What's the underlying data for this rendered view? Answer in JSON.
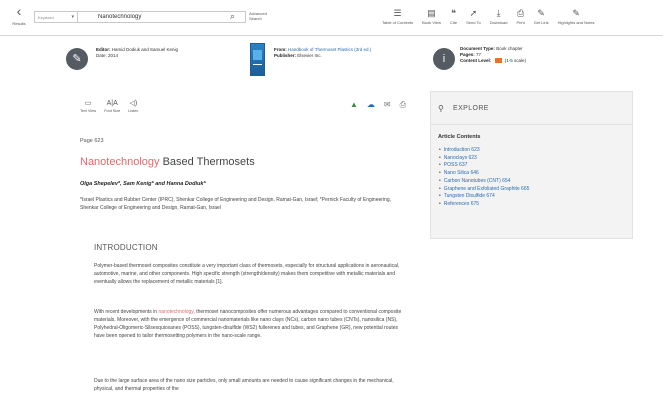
{
  "toolbar": {
    "back_label": "Results",
    "search_scope": "Keyword",
    "search_value": "Nanotechnology",
    "advanced_search": "Advanced Search",
    "tools": [
      {
        "icon": "table-of-contents-icon",
        "glyph": "☰",
        "label": "Table of Contents"
      },
      {
        "icon": "book-view-icon",
        "glyph": "▤",
        "label": "Book View"
      },
      {
        "icon": "cite-icon",
        "glyph": "❝",
        "label": "Cite"
      },
      {
        "icon": "send-to-icon",
        "glyph": "➚",
        "label": "Send To"
      },
      {
        "icon": "download-icon",
        "glyph": "⤓",
        "label": "Download"
      },
      {
        "icon": "print-icon",
        "glyph": "⎙",
        "label": "Print"
      },
      {
        "icon": "get-link-icon",
        "glyph": "✎",
        "label": "Get Link"
      },
      {
        "icon": "highlights-notes-icon",
        "glyph": "✎",
        "label": "Highlights and Notes"
      }
    ]
  },
  "header": {
    "editor_label": "Editor:",
    "editor_value": "Hamid Dodiuk and Samuel Kenig",
    "editor_line2": "Date: 2014",
    "from_label": "From:",
    "from_value": "Handbook of Thermoset Plastics (3rd ed.)",
    "publisher_label": "Publisher:",
    "publisher_value": "Elsevier Inc.",
    "doctype_label": "Document Type:",
    "doctype_value": "Book chapter",
    "pages_label": "Pages:",
    "pages_value": "77",
    "content_level_label": "Content Level:",
    "content_level_value": "(1-5 scale)"
  },
  "article": {
    "doc_tools": [
      {
        "icon": "text-view-icon",
        "glyph": "▭",
        "label": "Text View"
      },
      {
        "icon": "font-size-icon",
        "glyph": "A|A",
        "label": "Font Size"
      },
      {
        "icon": "listen-icon",
        "glyph": "◁)",
        "label": "Listen"
      }
    ],
    "page": "Page 623",
    "title_highlight": "Nanotechnology",
    "title_rest": " Based Thermosets",
    "authors": "Olga Shepelev*, Sam Kenig* and Hanna Dodiuk*",
    "affiliation": "*Israel Plastics and Rubber Center (IPRC), Shenkar College of Engineering and Design, Ramat-Gan, Israel; *Pernick Faculty of Engineering, Shenkar College of Engineering and Design, Ramat-Gan, Israel",
    "section": "INTRODUCTION",
    "p1": "Polymer-based thermoset composites constitute a very important class of thermosets, especially for structural applications in aeronautical, automotive, marine, and other components. High specific strength (strength/density) makes them competitive with metallic materials and eventually allows the replacement of metallic materials [1].",
    "p2_pre": "With recent developments in ",
    "p2_highlight": "nanotechnology",
    "p2_post": ", thermoset nanocomposites offer numerous advantages compared to conventional composite materials. Moreover, with the emergence of commercial nanomaterials like nano clays (NCs), carbon nano tubes (CNTs), nanosilica (NS), Polyhedral-Oligomeric-Silsesquioxanes (POSS), tungsten-disulfide (WS2) fullerenes and tubes, and Graphene (GR), new potential routes have been opened to tailor thermosetting polymers in the nano-scale range.",
    "p3": "Due to the large surface area of the nano size particles, only small amounts are needed to cause significant changes in the mechanical, physical, and thermal properties of the"
  },
  "explore": {
    "label": "EXPLORE",
    "contents_heading": "Article Contents",
    "items": [
      "Introduction 623",
      "Nanoclays 623",
      "POSS 637",
      "Nano Silica 646",
      "Carbon Nanotubes (CNT) 654",
      "Graphene and Exfoliated Graphite 665",
      "Tungsten Disulfide 674",
      "References 675"
    ]
  }
}
